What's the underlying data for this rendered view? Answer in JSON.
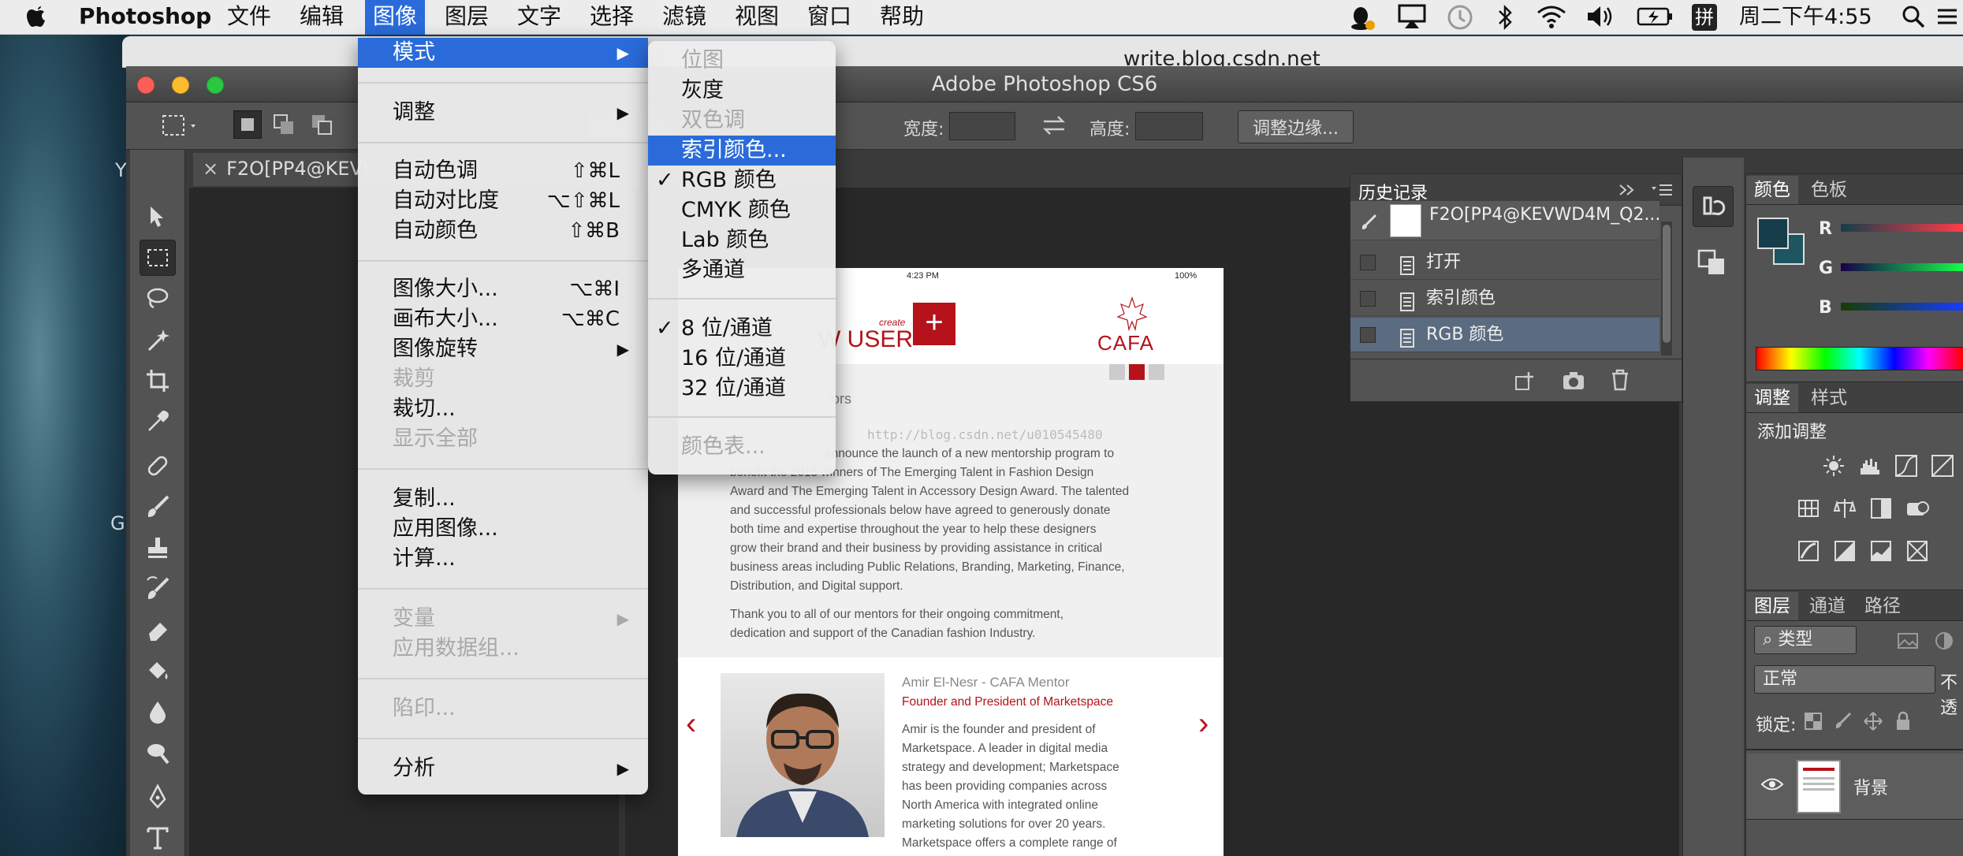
{
  "menubar": {
    "app_name": "Photoshop",
    "items": [
      "文件",
      "编辑",
      "图像",
      "图层",
      "文字",
      "选择",
      "滤镜",
      "视图",
      "窗口",
      "帮助"
    ],
    "active_item": "图像",
    "clock": "周二下午4:55",
    "input_method": "拼"
  },
  "desktop": {
    "text_1": "Y",
    "text_2": "G"
  },
  "safari": {
    "url_fragment": "write.blog.csdn.net"
  },
  "window": {
    "title": "Adobe Photoshop CS6"
  },
  "options_bar": {
    "width_label": "宽度:",
    "height_label": "高度:",
    "refine_edge_label": "调整边缘..."
  },
  "document_tab": {
    "close_glyph": "×",
    "name": "F2O[PP4@KEVWD4M_Q2..."
  },
  "image_menu": {
    "items": [
      {
        "label": "模式",
        "submenu": true,
        "highlighted": true
      },
      {
        "label": "调整",
        "submenu": true
      },
      {
        "label": "自动色调",
        "shortcut": "⇧⌘L"
      },
      {
        "label": "自动对比度",
        "shortcut": "⌥⇧⌘L"
      },
      {
        "label": "自动颜色",
        "shortcut": "⇧⌘B"
      },
      {
        "label": "图像大小...",
        "shortcut": "⌥⌘I"
      },
      {
        "label": "画布大小...",
        "shortcut": "⌥⌘C"
      },
      {
        "label": "图像旋转",
        "submenu": true
      },
      {
        "label": "裁剪",
        "disabled": true
      },
      {
        "label": "裁切..."
      },
      {
        "label": "显示全部",
        "disabled": true
      },
      {
        "label": "复制..."
      },
      {
        "label": "应用图像..."
      },
      {
        "label": "计算..."
      },
      {
        "label": "变量",
        "submenu": true,
        "disabled": true
      },
      {
        "label": "应用数据组...",
        "disabled": true
      },
      {
        "label": "陷印...",
        "disabled": true
      },
      {
        "label": "分析",
        "submenu": true
      }
    ]
  },
  "mode_submenu": {
    "items": [
      {
        "label": "位图",
        "disabled": true
      },
      {
        "label": "灰度"
      },
      {
        "label": "双色调",
        "disabled": true
      },
      {
        "label": "索引颜色...",
        "highlighted": true
      },
      {
        "label": "RGB 颜色",
        "checked": true
      },
      {
        "label": "CMYK 颜色"
      },
      {
        "label": "Lab 颜色"
      },
      {
        "label": "多通道"
      },
      {
        "label": "8 位/通道",
        "checked": true
      },
      {
        "label": "16 位/通道"
      },
      {
        "label": "32 位/通道"
      },
      {
        "label": "颜色表...",
        "disabled": true
      }
    ],
    "check_glyph": "✓"
  },
  "history_panel": {
    "title": "历史记录",
    "snapshot_name": "F2O[PP4@KEVWD4M_Q2...",
    "steps": [
      "打开",
      "索引颜色",
      "RGB 颜色"
    ],
    "selected_step": "RGB 颜色"
  },
  "color_panel": {
    "tabs": [
      "颜色",
      "色板"
    ],
    "channels": [
      "R",
      "G",
      "B"
    ],
    "foreground": "#163d4a",
    "background": "#1d5560"
  },
  "adjustments_panel": {
    "tabs": [
      "调整",
      "样式"
    ],
    "heading": "添加调整"
  },
  "layers_panel": {
    "tabs": [
      "图层",
      "通道",
      "路径"
    ],
    "filter_label": "类型",
    "blend_mode": "正常",
    "opacity_label": "不透",
    "lock_label": "锁定:",
    "layers": [
      {
        "name": "背景",
        "visible": true
      }
    ]
  },
  "document": {
    "status_time": "4:23 PM",
    "status_battery": "100%",
    "header_small": "create",
    "header_text": "W USER",
    "logo_text": "CAFA",
    "section_title": "tors",
    "watermark": "http://blog.csdn.net/u010545480",
    "paragraph_1_lines": [
      "announce the launch of a new mentorship program to",
      "benefit the 2015 winners of The Emerging Talent in Fashion Design",
      "Award and The Emerging Talent in Accessory Design Award. The talented",
      "and successful professionals below have agreed to generously donate",
      "both time and expertise throughout the year to help these designers",
      "grow their brand and their business by providing assistance in critical",
      "business areas including Public Relations, Branding, Marketing, Finance,",
      "Distribution, and Digital support."
    ],
    "paragraph_2_lines": [
      "Thank you to all of our mentors for their ongoing commitment,",
      "dedication and support of the Canadian fashion Industry."
    ],
    "mentor_name": "Amir El-Nesr - CAFA Mentor",
    "mentor_role": "Founder and President of Marketspace",
    "mentor_bio_lines": [
      "Amir is the founder and president of",
      "Marketspace. A leader in digital media",
      "strategy and development; Marketspace",
      "has been providing companies across",
      "North America with integrated online",
      "marketing solutions for over 20 years.",
      "Marketspace offers a complete range of"
    ],
    "prev_glyph": "‹",
    "next_glyph": "›",
    "plus_glyph": "+",
    "accent_color": "#b5121b"
  },
  "colors": {
    "menu_highlight": "#2a6bd9",
    "ps_panel": "#535353",
    "ps_dark": "#282828"
  }
}
